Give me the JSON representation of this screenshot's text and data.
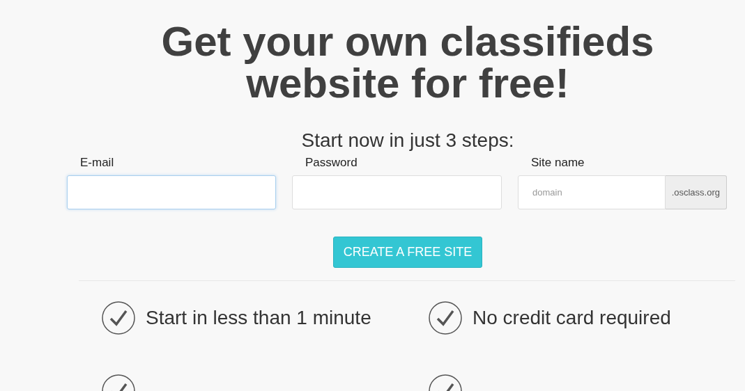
{
  "heading": "Get your own classifieds website for free!",
  "subheading": "Start now in just 3 steps:",
  "fields": [
    {
      "kind": "text",
      "label": "E-mail",
      "focused": true
    },
    {
      "kind": "text",
      "label": "Password",
      "focused": false
    },
    {
      "kind": "addon",
      "label": "Site name",
      "placeholder": "domain",
      "suffix": ".osclass.org",
      "focused": false
    }
  ],
  "button": "CREATE A FREE SITE",
  "features": [
    {
      "text": "Start in less than 1 minute"
    },
    {
      "text": "No credit card required"
    }
  ]
}
